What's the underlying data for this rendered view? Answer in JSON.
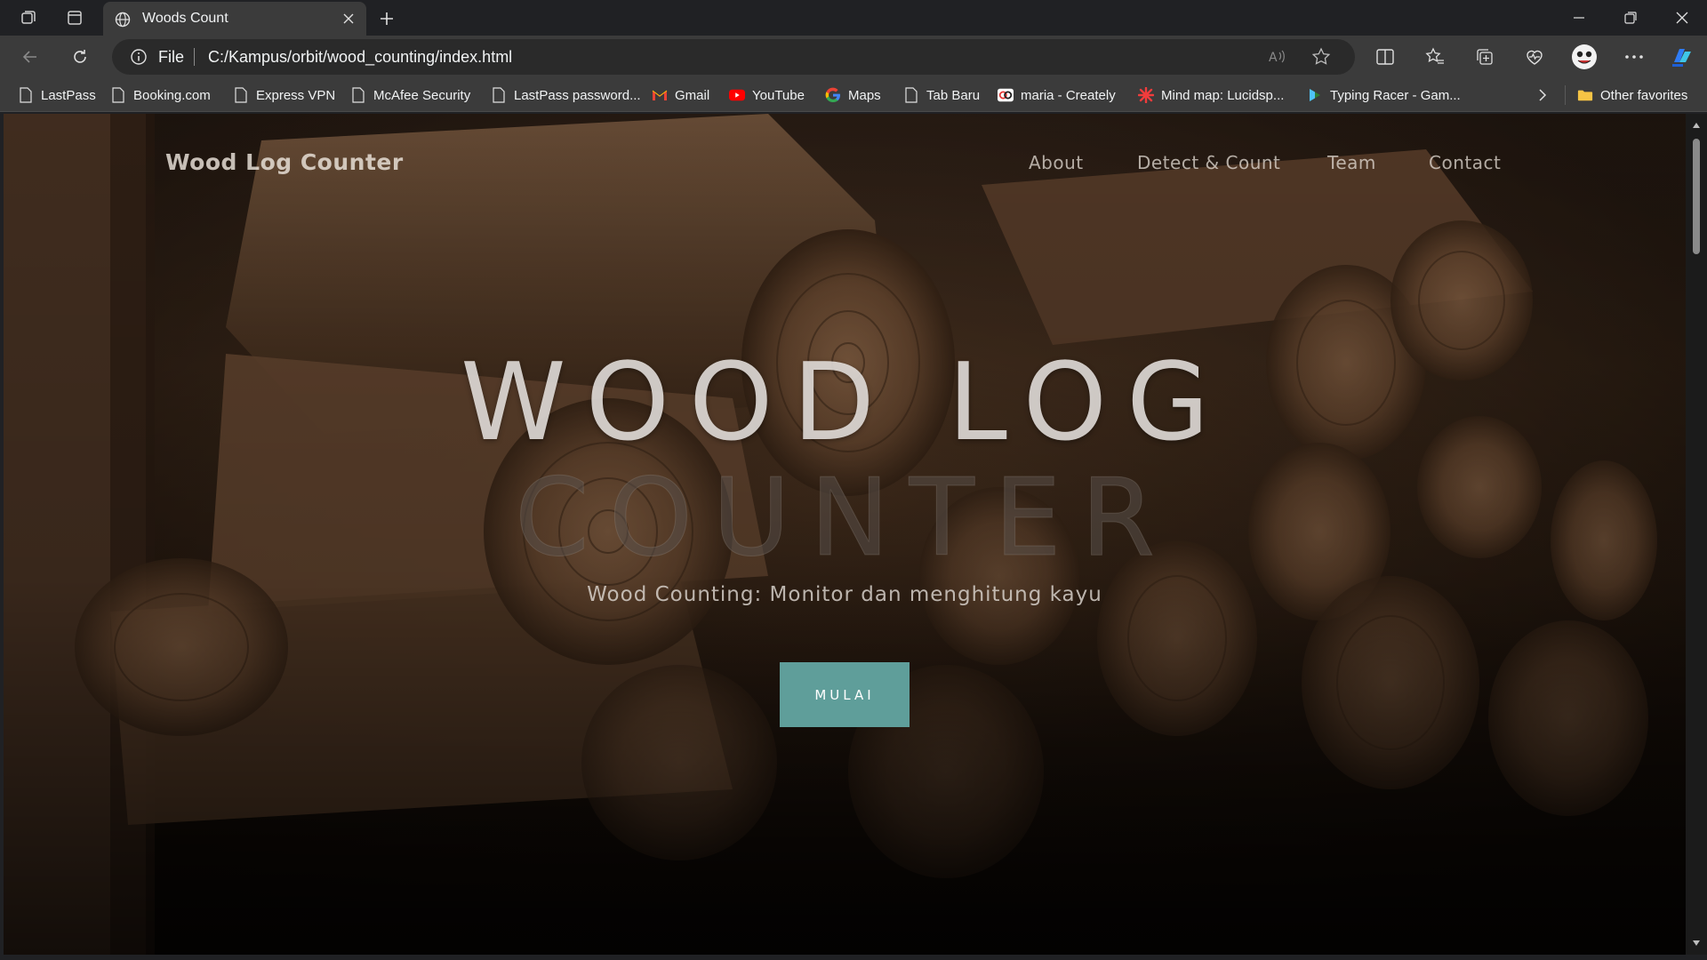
{
  "tab": {
    "title": "Woods Count"
  },
  "address": {
    "scheme_label": "File",
    "url": "C:/Kampus/orbit/wood_counting/index.html"
  },
  "bookmarks": [
    {
      "label": "LastPass",
      "icon": "page-icon"
    },
    {
      "label": "Booking.com",
      "icon": "page-icon"
    },
    {
      "label": "Express VPN",
      "icon": "page-icon"
    },
    {
      "label": "McAfee Security",
      "icon": "page-icon"
    },
    {
      "label": "LastPass password...",
      "icon": "page-icon"
    },
    {
      "label": "Gmail",
      "icon": "gmail-icon"
    },
    {
      "label": "YouTube",
      "icon": "youtube-icon"
    },
    {
      "label": "Maps",
      "icon": "google-icon"
    },
    {
      "label": "Tab Baru",
      "icon": "page-icon"
    },
    {
      "label": "maria - Creately",
      "icon": "creately-icon"
    },
    {
      "label": "Mind map: Lucidsp...",
      "icon": "lucid-icon"
    },
    {
      "label": "Typing Racer - Gam...",
      "icon": "typing-racer-icon"
    }
  ],
  "other_favorites": {
    "label": "Other favorites",
    "icon": "folder-icon"
  },
  "site": {
    "brand": "Wood Log Counter",
    "nav": [
      "About",
      "Detect & Count",
      "Team",
      "Contact"
    ],
    "headline_line1": "WOOD LOG",
    "headline_line2": "COUNTER",
    "subtitle": "Wood Counting: Monitor dan menghitung kayu",
    "cta": "MULAI"
  },
  "colors": {
    "chrome_dark": "#202124",
    "chrome_toolbar": "#3b3b3b",
    "cta_teal": "#5f9e9a",
    "youtube_red": "#ff0000",
    "folder_yellow": "#f6c445"
  }
}
